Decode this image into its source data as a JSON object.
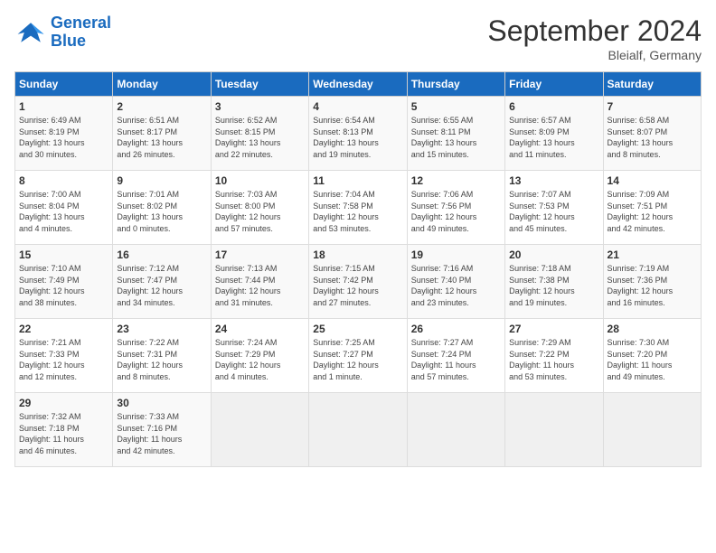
{
  "header": {
    "logo_line1": "General",
    "logo_line2": "Blue",
    "month": "September 2024",
    "location": "Bleialf, Germany"
  },
  "days_of_week": [
    "Sunday",
    "Monday",
    "Tuesday",
    "Wednesday",
    "Thursday",
    "Friday",
    "Saturday"
  ],
  "weeks": [
    [
      {
        "num": "1",
        "lines": [
          "Sunrise: 6:49 AM",
          "Sunset: 8:19 PM",
          "Daylight: 13 hours",
          "and 30 minutes."
        ]
      },
      {
        "num": "2",
        "lines": [
          "Sunrise: 6:51 AM",
          "Sunset: 8:17 PM",
          "Daylight: 13 hours",
          "and 26 minutes."
        ]
      },
      {
        "num": "3",
        "lines": [
          "Sunrise: 6:52 AM",
          "Sunset: 8:15 PM",
          "Daylight: 13 hours",
          "and 22 minutes."
        ]
      },
      {
        "num": "4",
        "lines": [
          "Sunrise: 6:54 AM",
          "Sunset: 8:13 PM",
          "Daylight: 13 hours",
          "and 19 minutes."
        ]
      },
      {
        "num": "5",
        "lines": [
          "Sunrise: 6:55 AM",
          "Sunset: 8:11 PM",
          "Daylight: 13 hours",
          "and 15 minutes."
        ]
      },
      {
        "num": "6",
        "lines": [
          "Sunrise: 6:57 AM",
          "Sunset: 8:09 PM",
          "Daylight: 13 hours",
          "and 11 minutes."
        ]
      },
      {
        "num": "7",
        "lines": [
          "Sunrise: 6:58 AM",
          "Sunset: 8:07 PM",
          "Daylight: 13 hours",
          "and 8 minutes."
        ]
      }
    ],
    [
      {
        "num": "8",
        "lines": [
          "Sunrise: 7:00 AM",
          "Sunset: 8:04 PM",
          "Daylight: 13 hours",
          "and 4 minutes."
        ]
      },
      {
        "num": "9",
        "lines": [
          "Sunrise: 7:01 AM",
          "Sunset: 8:02 PM",
          "Daylight: 13 hours",
          "and 0 minutes."
        ]
      },
      {
        "num": "10",
        "lines": [
          "Sunrise: 7:03 AM",
          "Sunset: 8:00 PM",
          "Daylight: 12 hours",
          "and 57 minutes."
        ]
      },
      {
        "num": "11",
        "lines": [
          "Sunrise: 7:04 AM",
          "Sunset: 7:58 PM",
          "Daylight: 12 hours",
          "and 53 minutes."
        ]
      },
      {
        "num": "12",
        "lines": [
          "Sunrise: 7:06 AM",
          "Sunset: 7:56 PM",
          "Daylight: 12 hours",
          "and 49 minutes."
        ]
      },
      {
        "num": "13",
        "lines": [
          "Sunrise: 7:07 AM",
          "Sunset: 7:53 PM",
          "Daylight: 12 hours",
          "and 45 minutes."
        ]
      },
      {
        "num": "14",
        "lines": [
          "Sunrise: 7:09 AM",
          "Sunset: 7:51 PM",
          "Daylight: 12 hours",
          "and 42 minutes."
        ]
      }
    ],
    [
      {
        "num": "15",
        "lines": [
          "Sunrise: 7:10 AM",
          "Sunset: 7:49 PM",
          "Daylight: 12 hours",
          "and 38 minutes."
        ]
      },
      {
        "num": "16",
        "lines": [
          "Sunrise: 7:12 AM",
          "Sunset: 7:47 PM",
          "Daylight: 12 hours",
          "and 34 minutes."
        ]
      },
      {
        "num": "17",
        "lines": [
          "Sunrise: 7:13 AM",
          "Sunset: 7:44 PM",
          "Daylight: 12 hours",
          "and 31 minutes."
        ]
      },
      {
        "num": "18",
        "lines": [
          "Sunrise: 7:15 AM",
          "Sunset: 7:42 PM",
          "Daylight: 12 hours",
          "and 27 minutes."
        ]
      },
      {
        "num": "19",
        "lines": [
          "Sunrise: 7:16 AM",
          "Sunset: 7:40 PM",
          "Daylight: 12 hours",
          "and 23 minutes."
        ]
      },
      {
        "num": "20",
        "lines": [
          "Sunrise: 7:18 AM",
          "Sunset: 7:38 PM",
          "Daylight: 12 hours",
          "and 19 minutes."
        ]
      },
      {
        "num": "21",
        "lines": [
          "Sunrise: 7:19 AM",
          "Sunset: 7:36 PM",
          "Daylight: 12 hours",
          "and 16 minutes."
        ]
      }
    ],
    [
      {
        "num": "22",
        "lines": [
          "Sunrise: 7:21 AM",
          "Sunset: 7:33 PM",
          "Daylight: 12 hours",
          "and 12 minutes."
        ]
      },
      {
        "num": "23",
        "lines": [
          "Sunrise: 7:22 AM",
          "Sunset: 7:31 PM",
          "Daylight: 12 hours",
          "and 8 minutes."
        ]
      },
      {
        "num": "24",
        "lines": [
          "Sunrise: 7:24 AM",
          "Sunset: 7:29 PM",
          "Daylight: 12 hours",
          "and 4 minutes."
        ]
      },
      {
        "num": "25",
        "lines": [
          "Sunrise: 7:25 AM",
          "Sunset: 7:27 PM",
          "Daylight: 12 hours",
          "and 1 minute."
        ]
      },
      {
        "num": "26",
        "lines": [
          "Sunrise: 7:27 AM",
          "Sunset: 7:24 PM",
          "Daylight: 11 hours",
          "and 57 minutes."
        ]
      },
      {
        "num": "27",
        "lines": [
          "Sunrise: 7:29 AM",
          "Sunset: 7:22 PM",
          "Daylight: 11 hours",
          "and 53 minutes."
        ]
      },
      {
        "num": "28",
        "lines": [
          "Sunrise: 7:30 AM",
          "Sunset: 7:20 PM",
          "Daylight: 11 hours",
          "and 49 minutes."
        ]
      }
    ],
    [
      {
        "num": "29",
        "lines": [
          "Sunrise: 7:32 AM",
          "Sunset: 7:18 PM",
          "Daylight: 11 hours",
          "and 46 minutes."
        ]
      },
      {
        "num": "30",
        "lines": [
          "Sunrise: 7:33 AM",
          "Sunset: 7:16 PM",
          "Daylight: 11 hours",
          "and 42 minutes."
        ]
      },
      {
        "num": "",
        "lines": []
      },
      {
        "num": "",
        "lines": []
      },
      {
        "num": "",
        "lines": []
      },
      {
        "num": "",
        "lines": []
      },
      {
        "num": "",
        "lines": []
      }
    ]
  ]
}
